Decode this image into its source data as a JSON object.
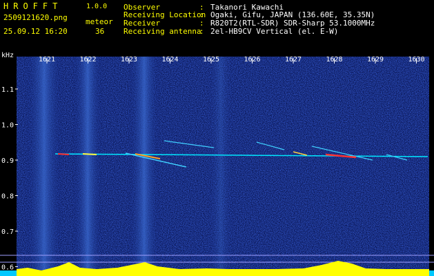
{
  "app": {
    "name": "HROFFT",
    "version": "1.0.0"
  },
  "file": {
    "name": "2509121620.png",
    "datetime": "25.09.12 16:20"
  },
  "detection": {
    "label": "meteor",
    "count": "36"
  },
  "info": [
    {
      "label": "Observer",
      "value": "Takanori Kawachi"
    },
    {
      "label": "Receiving Location",
      "value": "Ogaki, Gifu, JAPAN (136.60E, 35.35N)"
    },
    {
      "label": "Receiver",
      "value": "R820T2(RTL-SDR) SDR-Sharp 53.1000MHz"
    },
    {
      "label": "Receiving antenna",
      "value": "2el-HB9CV Vertical (el. E-W)"
    }
  ],
  "separator": ":",
  "y_axis": {
    "unit": "kHz",
    "ticks": [
      "1.1",
      "1.0",
      "0.9",
      "0.8",
      "0.7",
      "0.6"
    ]
  },
  "x_axis": {
    "ticks": [
      "1621",
      "1622",
      "1623",
      "1624",
      "1625",
      "1626",
      "1627",
      "1628",
      "1629",
      "1630"
    ]
  },
  "colors": {
    "header_text": "#ffff00",
    "info_text": "#ffffff",
    "background": "#000000",
    "noise": "#1a2a8a",
    "carrier": "#00ffff",
    "level_trace": "#ffff00"
  }
}
